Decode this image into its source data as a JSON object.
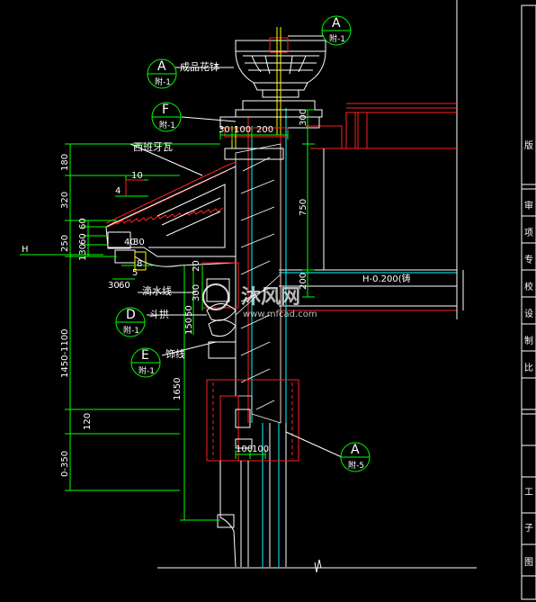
{
  "labels": {
    "flower_bowl": "成品花钵",
    "spanish_tile": "西班牙瓦",
    "drip_line": "滴水线",
    "bracket": "斗拱",
    "molding": "饰线",
    "floor_level": "H-0.200(铸"
  },
  "callouts": [
    {
      "letter": "A",
      "sheet": "附-1"
    },
    {
      "letter": "A",
      "sheet": "附-1"
    },
    {
      "letter": "F",
      "sheet": "附-1"
    },
    {
      "letter": "D",
      "sheet": "附-1"
    },
    {
      "letter": "E",
      "sheet": "附-1"
    },
    {
      "letter": "A",
      "sheet": "附-5"
    }
  ],
  "dims": {
    "top_30": "30",
    "top_100": "100",
    "top_200": "200",
    "right_300": "300",
    "right_750": "750",
    "right_200": "200",
    "left_180": "180",
    "left_320": "320",
    "left_250": "250",
    "left_60": "60",
    "left_130": "130",
    "left_60b": "60",
    "left_1450": "1450-1100",
    "left_120": "120",
    "left_0350": "0-350",
    "mid_1650": "1650",
    "mid_300": "300",
    "mid_20": "20",
    "mid_150": "150",
    "mid_50": "50",
    "eave_4": "4",
    "eave_10": "10",
    "eave_40": "40",
    "eave_30": "30",
    "sm_30": "30",
    "sm_60": "60",
    "sm_5": "5",
    "sm_8": "8",
    "bot_100a": "100",
    "bot_100b": "100",
    "datum_h": "H"
  },
  "title_block": [
    "版",
    "审",
    "项",
    "专",
    "校",
    "设",
    "制",
    "比",
    "工",
    "子",
    "图"
  ],
  "watermark": {
    "brand": "沐风网",
    "url": "www.mfcad.com"
  },
  "colors": {
    "background": "#000000",
    "dimension": "#00ff00",
    "outline": "#ffffff",
    "wall": "#00ffff",
    "section_red": "#ff2020",
    "accent_yellow": "#ffff00"
  }
}
